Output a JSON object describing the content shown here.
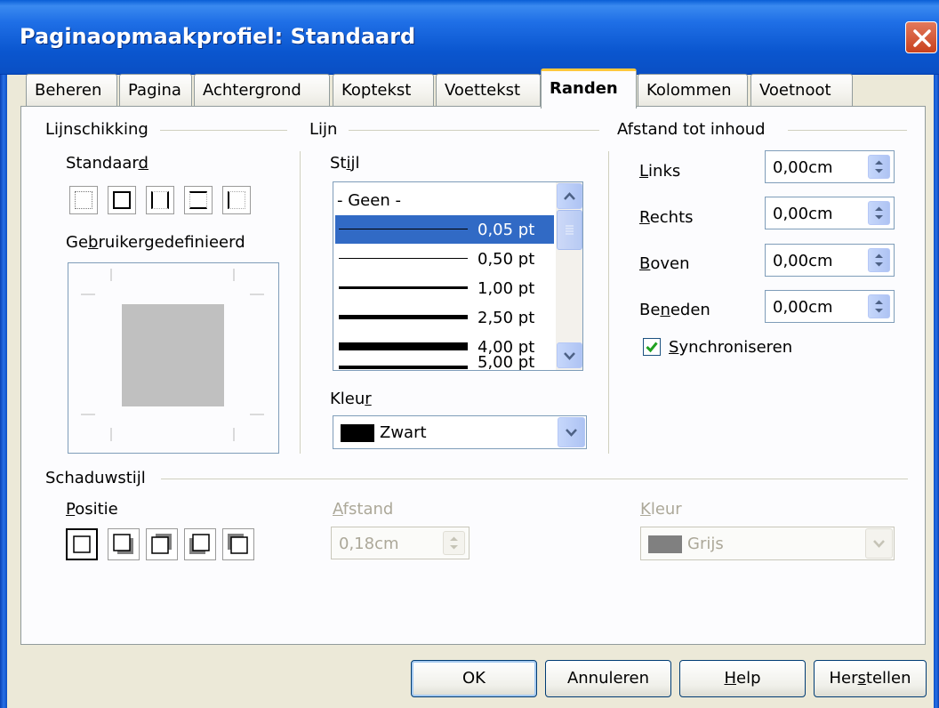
{
  "window": {
    "title": "Paginaopmaakprofiel: Standaard"
  },
  "tabs": [
    {
      "label": "Beheren",
      "active": false
    },
    {
      "label": "Pagina",
      "active": false
    },
    {
      "label": "Achtergrond",
      "active": false
    },
    {
      "label": "Koptekst",
      "active": false
    },
    {
      "label": "Voettekst",
      "active": false
    },
    {
      "label": "Randen",
      "active": true
    },
    {
      "label": "Kolommen",
      "active": false
    },
    {
      "label": "Voetnoot",
      "active": false
    }
  ],
  "arrangement": {
    "heading": "Lijnschikking",
    "default_label_pre": "Standaar",
    "default_label_key": "d",
    "custom_label_pre": "Ge",
    "custom_label_key": "b",
    "custom_label_post": "ruikergedefinieerd"
  },
  "line": {
    "heading": "Lijn",
    "style_label_pre": "St",
    "style_label_key": "i",
    "style_label_post": "jl",
    "styles": [
      "- Geen -",
      "0,05 pt",
      "0,50 pt",
      "1,00 pt",
      "2,50 pt",
      "4,00 pt",
      "5,00 pt"
    ],
    "selected_style": "0,05 pt",
    "color_label_pre": "Kleu",
    "color_label_key": "r",
    "color_value": "Zwart",
    "color_swatch": "#000000"
  },
  "spacing": {
    "heading": "Afstand tot inhoud",
    "left_label_key": "L",
    "left_label_post": "inks",
    "left_value": "0,00cm",
    "right_label_key": "R",
    "right_label_post": "echts",
    "right_value": "0,00cm",
    "top_label_key": "B",
    "top_label_post": "oven",
    "top_value": "0,00cm",
    "bottom_label_pre": "Be",
    "bottom_label_key": "n",
    "bottom_label_post": "eden",
    "bottom_value": "0,00cm",
    "sync_label_key": "S",
    "sync_label_post": "ynchroniseren",
    "sync_checked": true
  },
  "shadow": {
    "heading": "Schaduwstijl",
    "position_label_key": "P",
    "position_label_post": "ositie",
    "distance_label_key": "A",
    "distance_label_post": "fstand",
    "distance_value": "0,18cm",
    "color_label_key": "K",
    "color_label_post": "leur",
    "color_value": "Grijs",
    "color_swatch": "#808080"
  },
  "buttons": {
    "ok": "OK",
    "cancel": "Annuleren",
    "help_key": "H",
    "help_post": "elp",
    "reset_pre": "Her",
    "reset_key": "s",
    "reset_post": "tellen"
  }
}
